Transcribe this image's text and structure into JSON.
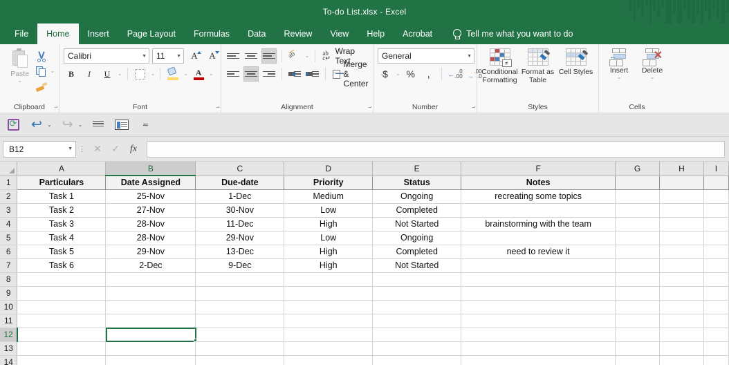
{
  "titlebar": {
    "title": "To-do List.xlsx  -  Excel"
  },
  "tabs": [
    {
      "label": "File",
      "active": false
    },
    {
      "label": "Home",
      "active": true
    },
    {
      "label": "Insert",
      "active": false
    },
    {
      "label": "Page Layout",
      "active": false
    },
    {
      "label": "Formulas",
      "active": false
    },
    {
      "label": "Data",
      "active": false
    },
    {
      "label": "Review",
      "active": false
    },
    {
      "label": "View",
      "active": false
    },
    {
      "label": "Help",
      "active": false
    },
    {
      "label": "Acrobat",
      "active": false
    }
  ],
  "tellme": {
    "label": "Tell me what you want to do",
    "icon": "lightbulb-icon"
  },
  "ribbon": {
    "clipboard": {
      "label": "Clipboard",
      "paste": "Paste",
      "cut_icon": "scissors-icon",
      "copy_icon": "copy-icon",
      "format_painter_icon": "format-painter-icon"
    },
    "font": {
      "label": "Font",
      "font_name": "Calibri",
      "font_size": "11",
      "grow_font": "A",
      "shrink_font": "A",
      "bold": "B",
      "italic": "I",
      "underline": "U",
      "borders_icon": "borders-icon",
      "fill_color_icon": "fill-color-icon",
      "font_color": "A"
    },
    "alignment": {
      "label": "Alignment",
      "wrap_text": "Wrap Text",
      "merge_center": "Merge & Center",
      "align_top_icon": "align-top-icon",
      "align_middle_icon": "align-middle-icon",
      "align_bottom_icon": "align-bottom-icon",
      "align_left_icon": "align-left-icon",
      "align_center_icon": "align-center-icon",
      "align_right_icon": "align-right-icon",
      "orientation_icon": "orientation-icon",
      "decrease_indent_icon": "decrease-indent-icon",
      "increase_indent_icon": "increase-indent-icon"
    },
    "number": {
      "label": "Number",
      "format": "General",
      "currency": "$",
      "percent": "%",
      "comma": ",",
      "decrease_decimal": ".00",
      "increase_decimal": ".00"
    },
    "styles": {
      "label": "Styles",
      "conditional_formatting": "Conditional Formatting",
      "format_as_table": "Format as Table",
      "cell_styles": "Cell Styles"
    },
    "cells": {
      "label": "Cells",
      "insert": "Insert",
      "delete": "Delete"
    }
  },
  "quick_access": {
    "save_icon": "save-sync-icon",
    "undo_icon": "undo-icon",
    "redo_icon": "redo-icon",
    "lines_icon": "lines-icon",
    "panel_icon": "panel-icon",
    "more_icon": "customize-toolbar-icon"
  },
  "formula_bar": {
    "name_box": "B12",
    "cancel_icon": "cancel-icon",
    "confirm_icon": "confirm-icon",
    "function_icon": "fx",
    "value": ""
  },
  "sheet": {
    "columns": [
      "A",
      "B",
      "C",
      "D",
      "E",
      "F",
      "G",
      "H",
      "I"
    ],
    "selected_column": "B",
    "selected_row": 12,
    "selected_cell": "B12",
    "rows": [
      {
        "n": 1,
        "cells": [
          "Particulars",
          "Date Assigned",
          "Due-date",
          "Priority",
          "Status",
          "Notes",
          "",
          "",
          ""
        ]
      },
      {
        "n": 2,
        "cells": [
          "Task 1",
          "25-Nov",
          "1-Dec",
          "Medium",
          "Ongoing",
          "recreating some topics",
          "",
          "",
          ""
        ]
      },
      {
        "n": 3,
        "cells": [
          "Task 2",
          "27-Nov",
          "30-Nov",
          "Low",
          "Completed",
          "",
          "",
          "",
          ""
        ]
      },
      {
        "n": 4,
        "cells": [
          "Task 3",
          "28-Nov",
          "11-Dec",
          "High",
          "Not Started",
          "brainstorming with the team",
          "",
          "",
          ""
        ]
      },
      {
        "n": 5,
        "cells": [
          "Task 4",
          "28-Nov",
          "29-Nov",
          "Low",
          "Ongoing",
          "",
          "",
          "",
          ""
        ]
      },
      {
        "n": 6,
        "cells": [
          "Task 5",
          "29-Nov",
          "13-Dec",
          "High",
          "Completed",
          "need to review it",
          "",
          "",
          ""
        ]
      },
      {
        "n": 7,
        "cells": [
          "Task 6",
          "2-Dec",
          "9-Dec",
          "High",
          "Not Started",
          "",
          "",
          "",
          ""
        ]
      },
      {
        "n": 8,
        "cells": [
          "",
          "",
          "",
          "",
          "",
          "",
          "",
          "",
          ""
        ]
      },
      {
        "n": 9,
        "cells": [
          "",
          "",
          "",
          "",
          "",
          "",
          "",
          "",
          ""
        ]
      },
      {
        "n": 10,
        "cells": [
          "",
          "",
          "",
          "",
          "",
          "",
          "",
          "",
          ""
        ]
      },
      {
        "n": 11,
        "cells": [
          "",
          "",
          "",
          "",
          "",
          "",
          "",
          "",
          ""
        ]
      },
      {
        "n": 12,
        "cells": [
          "",
          "",
          "",
          "",
          "",
          "",
          "",
          "",
          ""
        ]
      },
      {
        "n": 13,
        "cells": [
          "",
          "",
          "",
          "",
          "",
          "",
          "",
          "",
          ""
        ]
      },
      {
        "n": 14,
        "cells": [
          "",
          "",
          "",
          "",
          "",
          "",
          "",
          "",
          ""
        ]
      }
    ]
  },
  "colors": {
    "excel_green": "#217346",
    "ribbon_bg": "#f8f8f8",
    "header_gray": "#e6e6e6",
    "selection_green": "#217346"
  }
}
